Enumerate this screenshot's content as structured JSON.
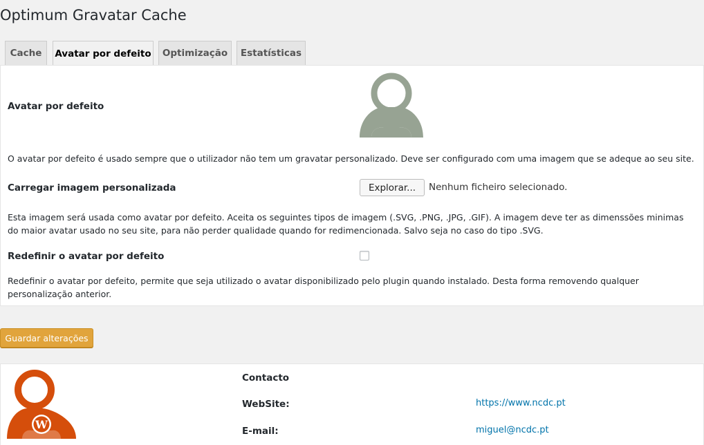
{
  "page": {
    "title": "Optimum Gravatar Cache"
  },
  "tabs": [
    {
      "label": "Cache",
      "active": false
    },
    {
      "label": "Avatar por defeito",
      "active": true
    },
    {
      "label": "Optimização",
      "active": false
    },
    {
      "label": "Estatísticas",
      "active": false
    }
  ],
  "settings": {
    "default_avatar": {
      "label": "Avatar por defeito",
      "description": "O avatar por defeito é usado sempre que o utilizador não tem um gravatar personalizado. Deve ser configurado com uma imagem que se adeque ao seu site."
    },
    "upload": {
      "label": "Carregar imagem personalizada",
      "button_label": "Explorar...",
      "status": "Nenhum ficheiro selecionado.",
      "description": "Esta imagem será usada como avatar por defeito. Aceita os seguintes tipos de imagem (.SVG, .PNG, .JPG, .GIF). A imagem deve ter as dimenssões minimas do maior avatar usado no seu site, para não perder qualidade quando for redimencionada. Salvo seja no caso do tipo .SVG."
    },
    "reset": {
      "label": "Redefinir o avatar por defeito",
      "checked": false,
      "description": "Redefinir o avatar por defeito, permite que seja utilizado o avatar disponibilizado pelo plugin quando instalado. Desta forma removendo qualquer personalização anterior."
    }
  },
  "actions": {
    "save_label": "Guardar alterações"
  },
  "footer": {
    "contact_title": "Contacto",
    "website_label": "WebSite:",
    "website_value": "https://www.ncdc.pt",
    "email_label": "E-mail:",
    "email_value": "miguel@ncdc.pt"
  },
  "colors": {
    "default_avatar": "#97a393",
    "logo_avatar": "#d54e0b",
    "accent_button": "#e1a43c",
    "link": "#0073aa"
  },
  "icons": {
    "default_avatar": "user-silhouette-icon",
    "plugin_logo": "wordpress-user-icon"
  }
}
